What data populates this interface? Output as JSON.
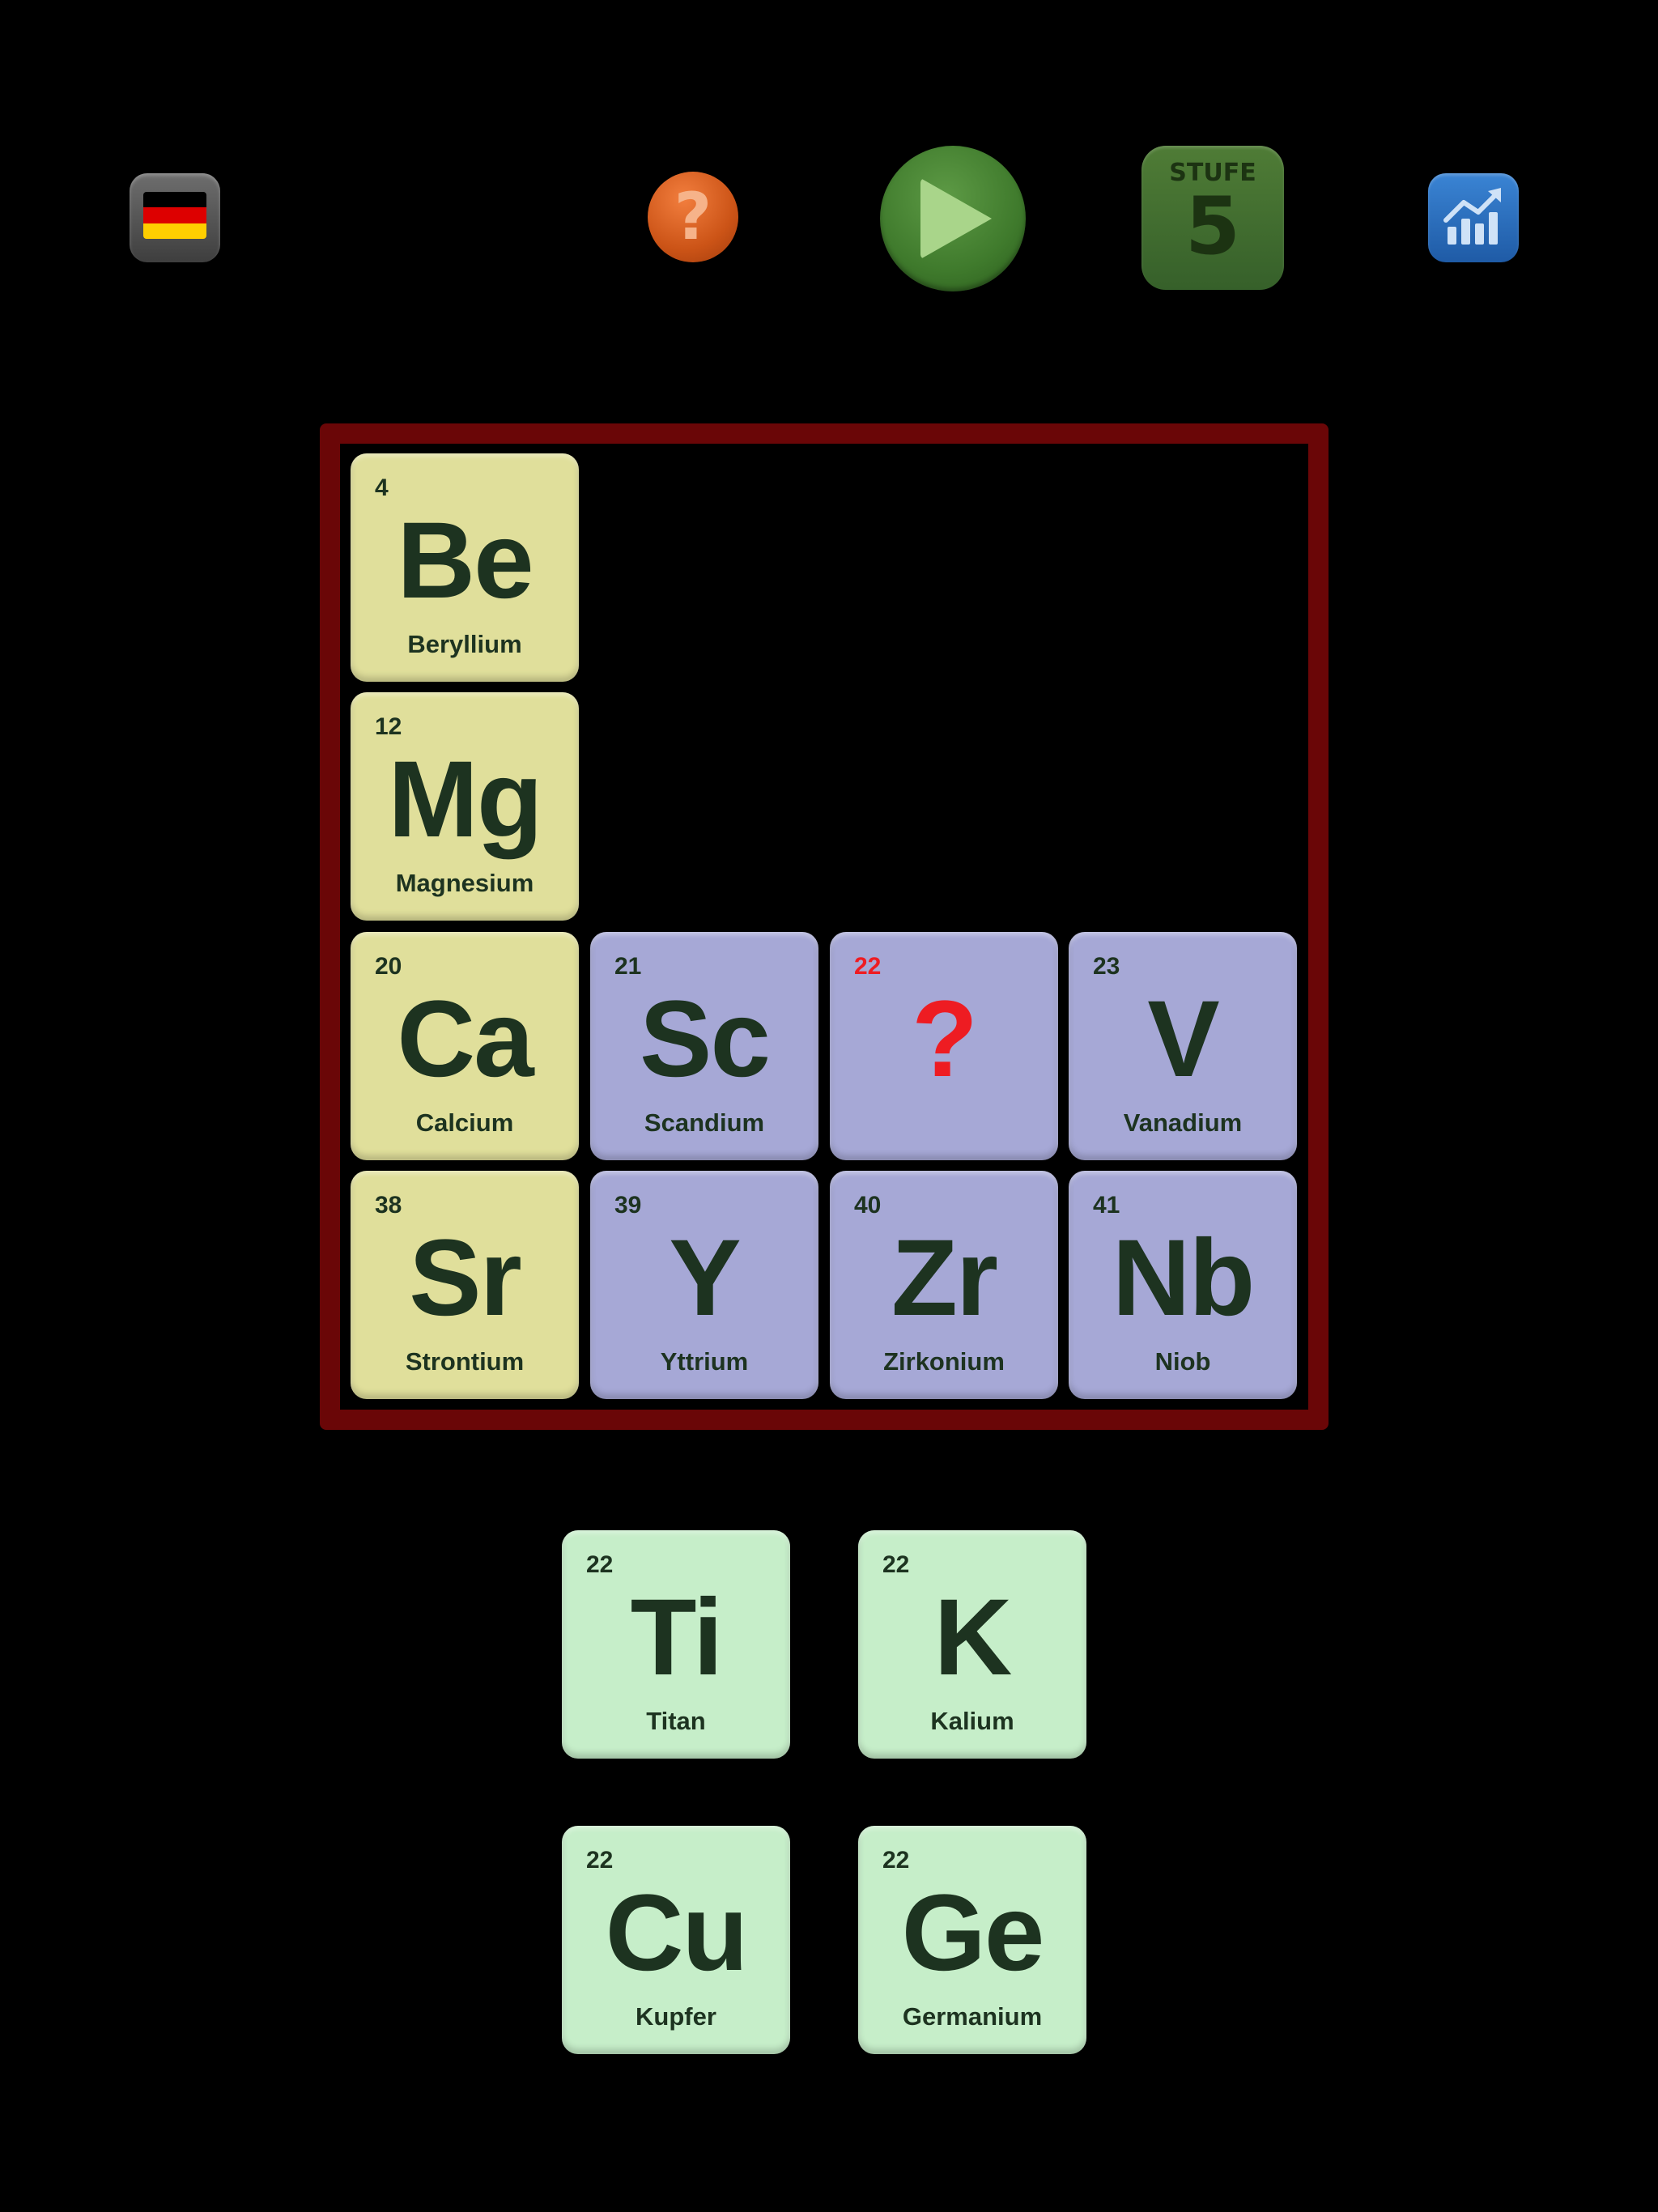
{
  "toolbar": {
    "language_icon": "german-flag-icon",
    "flag_colors": [
      "#000000",
      "#dd0000",
      "#ffce00"
    ],
    "help_label": "?",
    "play_icon": "play-icon",
    "level_label": "STUFE",
    "level_value": "5",
    "stats_icon": "bar-chart-trend-icon"
  },
  "board": {
    "tiles": [
      {
        "number": "4",
        "symbol": "Be",
        "name": "Beryllium",
        "color": "yellow"
      },
      {
        "number": "12",
        "symbol": "Mg",
        "name": "Magnesium",
        "color": "yellow"
      },
      {
        "number": "20",
        "symbol": "Ca",
        "name": "Calcium",
        "color": "yellow"
      },
      {
        "number": "21",
        "symbol": "Sc",
        "name": "Scandium",
        "color": "violet"
      },
      {
        "number": "22",
        "symbol": "?",
        "name": "",
        "color": "violet",
        "missing": true
      },
      {
        "number": "23",
        "symbol": "V",
        "name": "Vanadium",
        "color": "violet"
      },
      {
        "number": "38",
        "symbol": "Sr",
        "name": "Strontium",
        "color": "yellow"
      },
      {
        "number": "39",
        "symbol": "Y",
        "name": "Yttrium",
        "color": "violet"
      },
      {
        "number": "40",
        "symbol": "Zr",
        "name": "Zirkonium",
        "color": "violet"
      },
      {
        "number": "41",
        "symbol": "Nb",
        "name": "Niob",
        "color": "violet"
      }
    ]
  },
  "choices": [
    {
      "number": "22",
      "symbol": "Ti",
      "name": "Titan"
    },
    {
      "number": "22",
      "symbol": "K",
      "name": "Kalium"
    },
    {
      "number": "22",
      "symbol": "Cu",
      "name": "Kupfer"
    },
    {
      "number": "22",
      "symbol": "Ge",
      "name": "Germanium"
    }
  ],
  "colors": {
    "frame": "#6a0607",
    "alkaline_earth": "#e0df9b",
    "transition": "#a6a8d6",
    "choice": "#c6eec9",
    "missing_highlight": "#ee1c22",
    "text": "#1d3320"
  }
}
